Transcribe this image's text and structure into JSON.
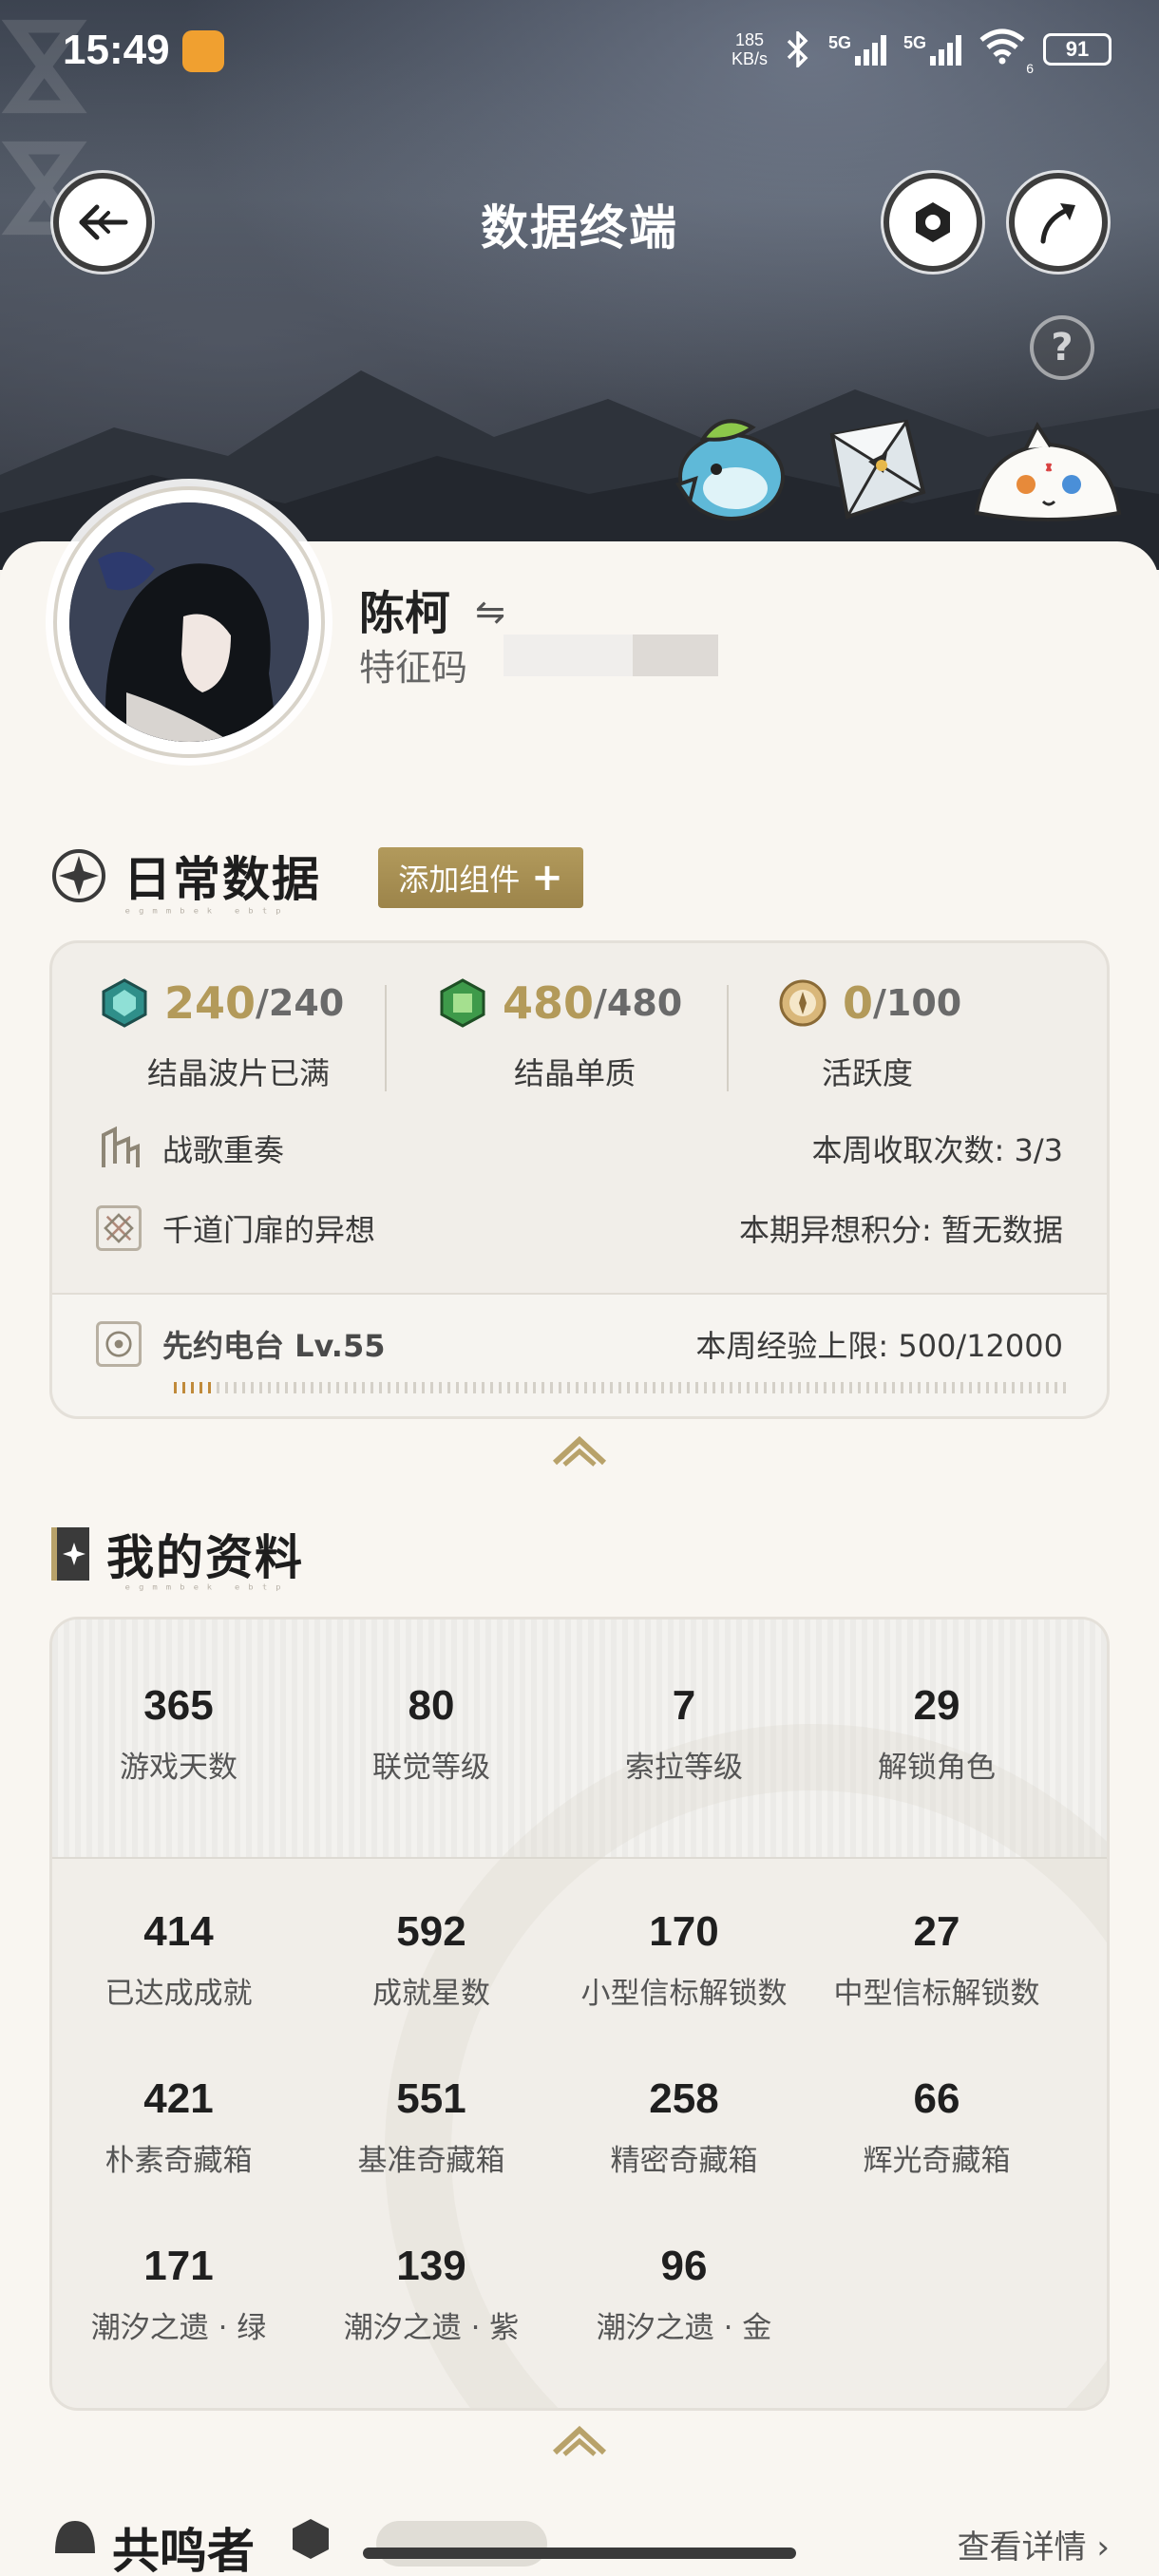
{
  "status_bar": {
    "time": "15:49",
    "net_speed_value": "185",
    "net_speed_unit": "KB/s",
    "signal1": "5G",
    "signal2": "5G",
    "wifi_sub": "6",
    "battery": "91"
  },
  "header": {
    "title": "数据终端"
  },
  "help": {
    "label": "?"
  },
  "profile": {
    "name": "陈柯",
    "switch_glyph": "⇋",
    "code_label": "特征码"
  },
  "daily": {
    "title": "日常数据",
    "subtitle": "ᵉᵍᵐᵐᵇᵉᵏ ᵉᵇᵗᵖ",
    "add_widget_label": "添加组件",
    "add_widget_plus": "+",
    "stats": [
      {
        "value": "240",
        "max": "/240",
        "label": "结晶波片已满"
      },
      {
        "value": "480",
        "max": "/480",
        "label": "结晶单质"
      },
      {
        "value": "0",
        "max": "/100",
        "label": "活跃度"
      }
    ],
    "rows": [
      {
        "name": "战歌重奏",
        "info": "本周收取次数: 3/3"
      },
      {
        "name": "千道门扉的异想",
        "info": "本期异想积分: 暂无数据"
      }
    ],
    "radio": {
      "name": "先约电台 Lv.55",
      "info": "本周经验上限: 500/12000",
      "progress": 0.0417
    }
  },
  "my_profile": {
    "title": "我的资料",
    "subtitle": "ᵉᵍᵐᵐᵇᵉᵏ ᵉᵇᵗᵖ",
    "top_stats": [
      {
        "value": "365",
        "label": "游戏天数"
      },
      {
        "value": "80",
        "label": "联觉等级"
      },
      {
        "value": "7",
        "label": "索拉等级"
      },
      {
        "value": "29",
        "label": "解锁角色"
      }
    ],
    "stats": [
      {
        "value": "414",
        "label": "已达成成就"
      },
      {
        "value": "592",
        "label": "成就星数"
      },
      {
        "value": "170",
        "label": "小型信标解锁数"
      },
      {
        "value": "27",
        "label": "中型信标解锁数"
      },
      {
        "value": "421",
        "label": "朴素奇藏箱"
      },
      {
        "value": "551",
        "label": "基准奇藏箱"
      },
      {
        "value": "258",
        "label": "精密奇藏箱"
      },
      {
        "value": "66",
        "label": "辉光奇藏箱"
      },
      {
        "value": "171",
        "label": "潮汐之遗 · 绿"
      },
      {
        "value": "139",
        "label": "潮汐之遗 · 紫"
      },
      {
        "value": "96",
        "label": "潮汐之遗 · 金"
      }
    ]
  },
  "bottom": {
    "partial_title": "共鸣者",
    "view_details": "查看详情 ›"
  },
  "colors": {
    "accent_gold": "#b39a5a",
    "button_gold": "#a58d51",
    "panel_bg": "#f9f6f1",
    "progress": "#c08a3a"
  }
}
